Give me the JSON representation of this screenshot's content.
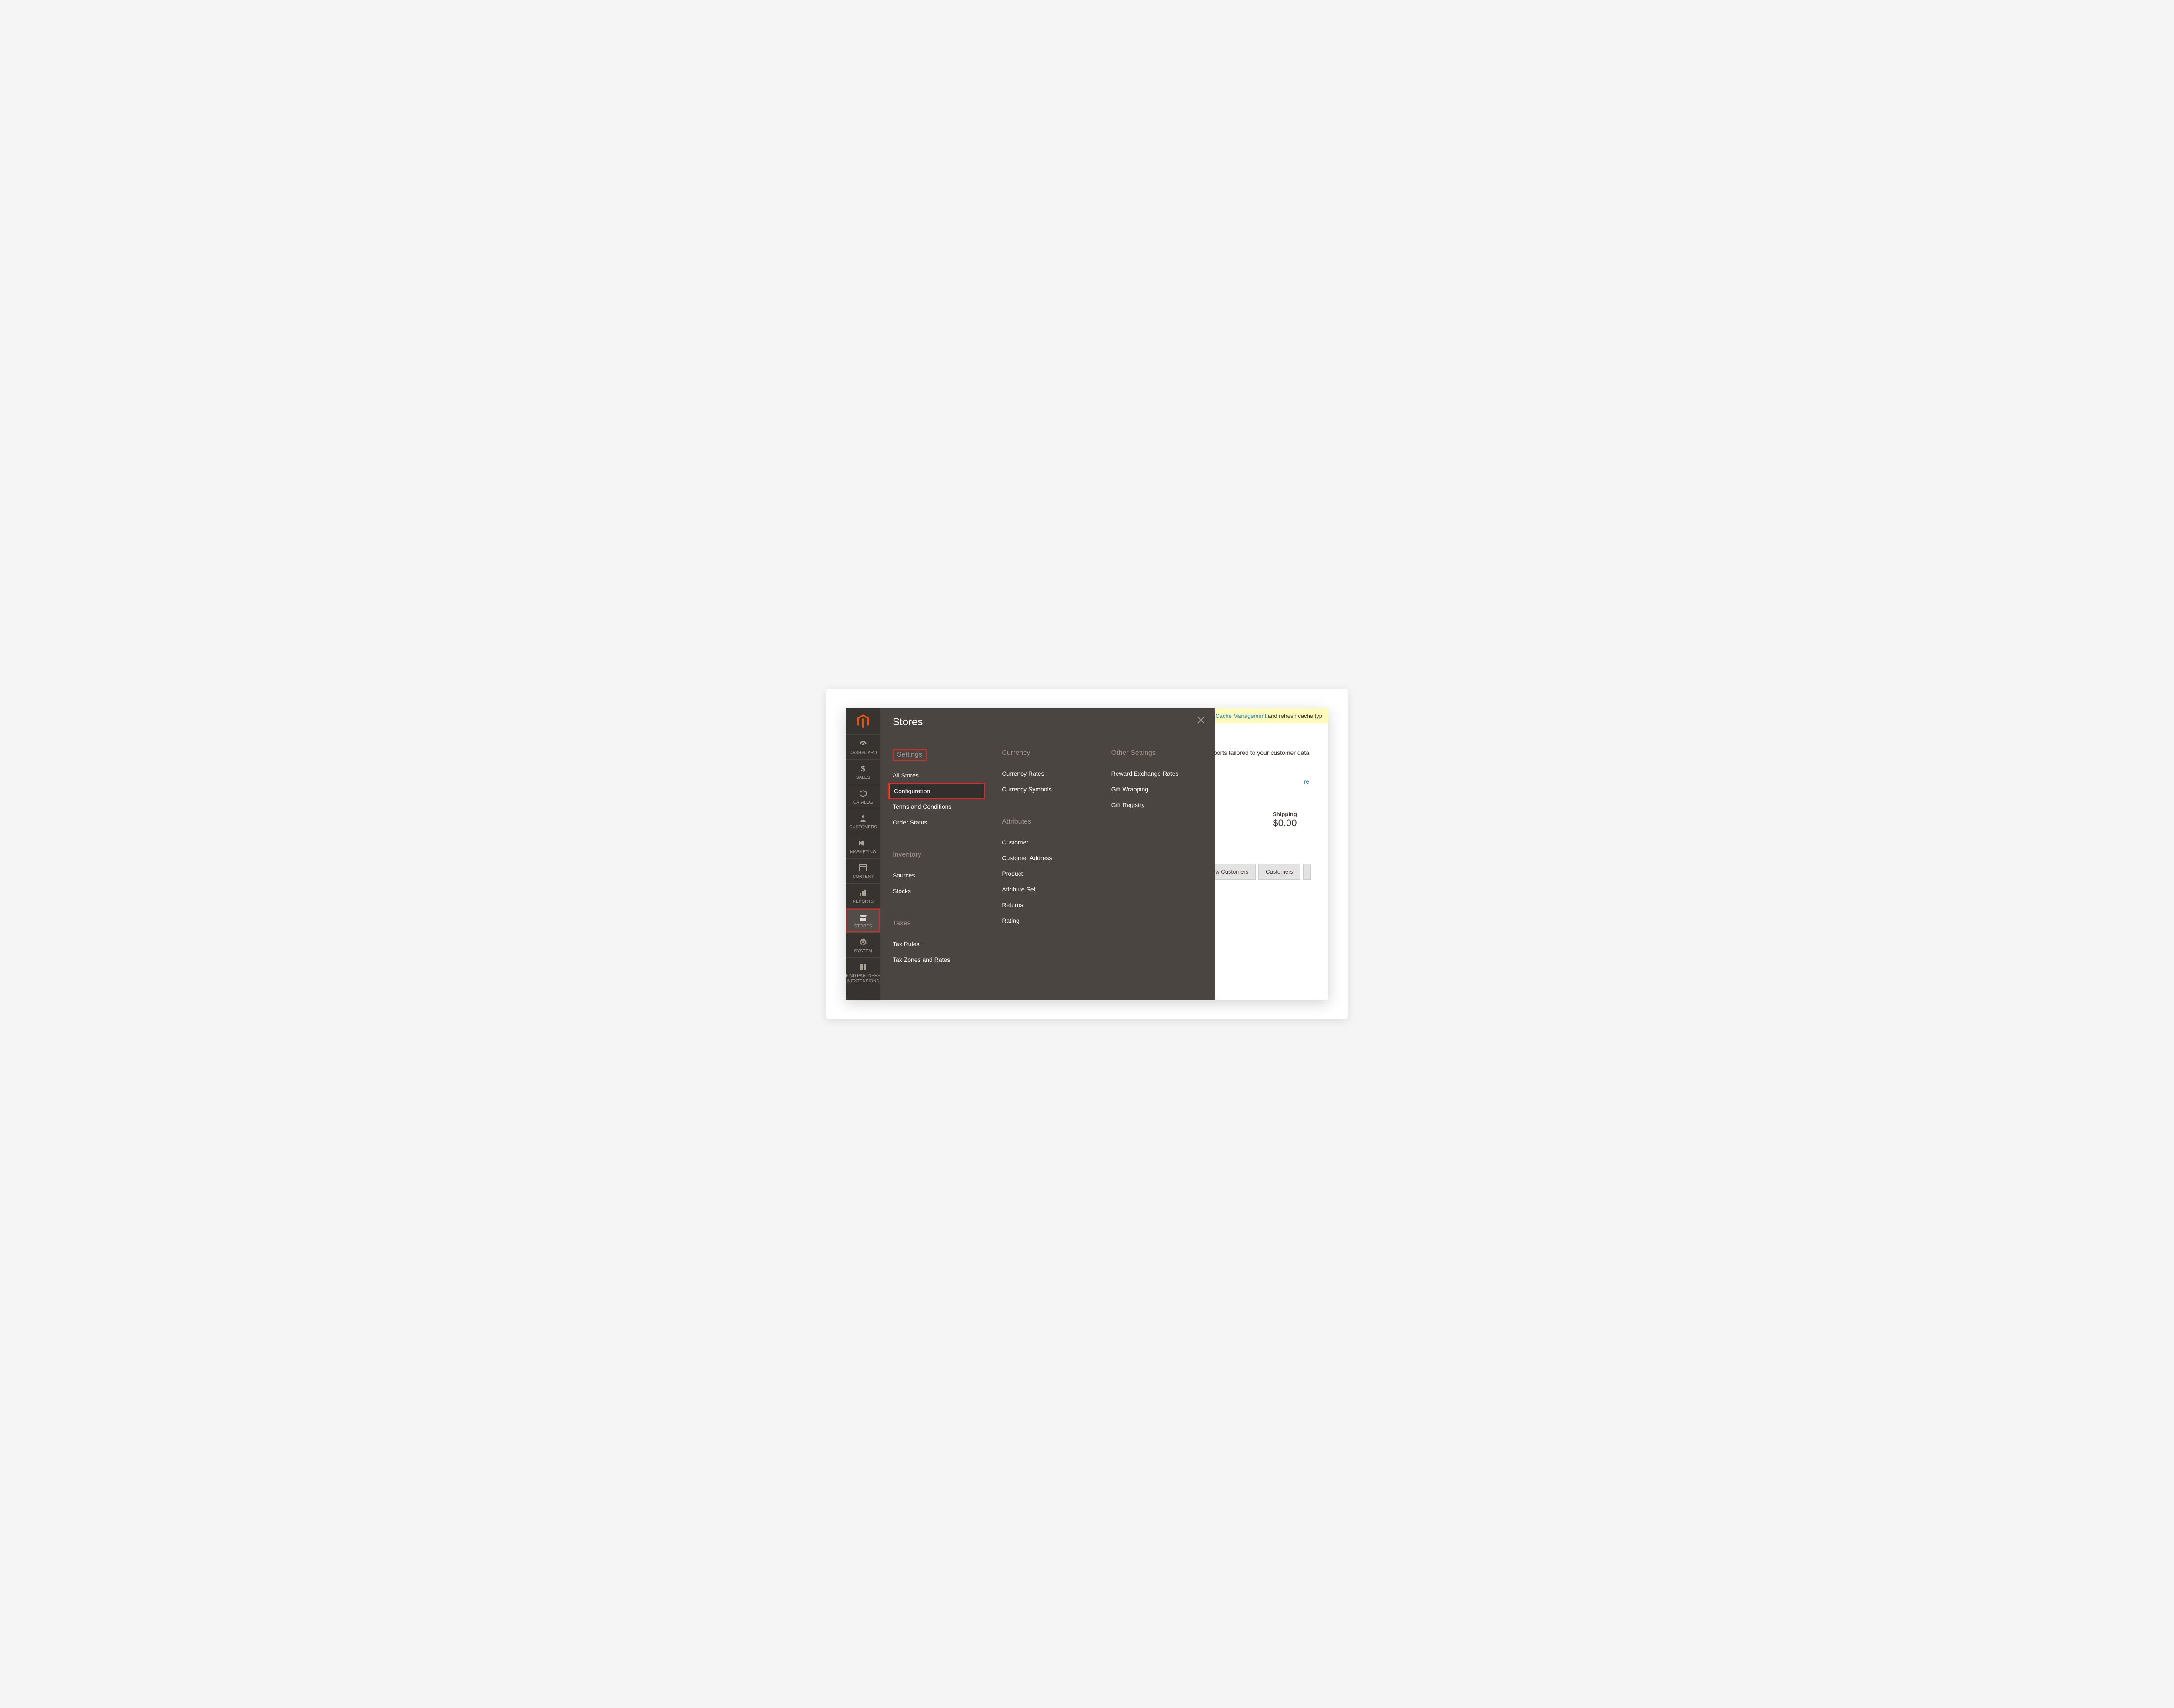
{
  "sidebar": {
    "items": [
      {
        "label": "DASHBOARD",
        "icon": "gauge"
      },
      {
        "label": "SALES",
        "icon": "dollar"
      },
      {
        "label": "CATALOG",
        "icon": "box"
      },
      {
        "label": "CUSTOMERS",
        "icon": "person"
      },
      {
        "label": "MARKETING",
        "icon": "megaphone"
      },
      {
        "label": "CONTENT",
        "icon": "layout"
      },
      {
        "label": "REPORTS",
        "icon": "bars"
      },
      {
        "label": "STORES",
        "icon": "store"
      },
      {
        "label": "SYSTEM",
        "icon": "gear"
      },
      {
        "label": "FIND PARTNERS & EXTENSIONS",
        "icon": "blocks"
      }
    ]
  },
  "flyout": {
    "title": "Stores",
    "columns": [
      {
        "groups": [
          {
            "heading": "Settings",
            "heading_highlight": true,
            "items": [
              {
                "label": "All Stores"
              },
              {
                "label": "Configuration",
                "active": true,
                "highlight": true
              },
              {
                "label": "Terms and Conditions"
              },
              {
                "label": "Order Status"
              }
            ]
          },
          {
            "heading": "Inventory",
            "items": [
              {
                "label": "Sources"
              },
              {
                "label": "Stocks"
              }
            ]
          },
          {
            "heading": "Taxes",
            "items": [
              {
                "label": "Tax Rules"
              },
              {
                "label": "Tax Zones and Rates"
              }
            ]
          }
        ]
      },
      {
        "groups": [
          {
            "heading": "Currency",
            "items": [
              {
                "label": "Currency Rates"
              },
              {
                "label": "Currency Symbols"
              }
            ]
          },
          {
            "heading": "Attributes",
            "items": [
              {
                "label": "Customer"
              },
              {
                "label": "Customer Address"
              },
              {
                "label": "Product"
              },
              {
                "label": "Attribute Set"
              },
              {
                "label": "Returns"
              },
              {
                "label": "Rating"
              }
            ]
          }
        ]
      },
      {
        "groups": [
          {
            "heading": "Other Settings",
            "items": [
              {
                "label": "Reward Exchange Rates"
              },
              {
                "label": "Gift Wrapping"
              },
              {
                "label": "Gift Registry"
              }
            ]
          }
        ]
      }
    ]
  },
  "notice": {
    "link": "Cache Management",
    "text": " and refresh cache typ"
  },
  "bg": {
    "reports_text": "reports tailored to your customer data.",
    "here_label": "re",
    "shipping_label": "Shipping",
    "shipping_value": "$0.00",
    "tabs": {
      "new_customers": "New Customers",
      "customers": "Customers"
    }
  }
}
